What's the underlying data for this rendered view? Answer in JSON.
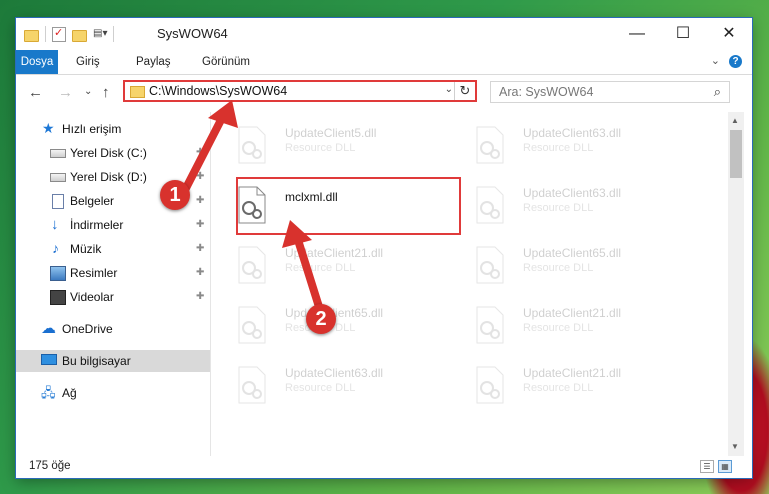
{
  "window": {
    "title": "SysWOW64",
    "minimize": "—",
    "maximize": "☐",
    "close": "✕"
  },
  "ribbon": {
    "tabs": [
      "Dosya",
      "Giriş",
      "Paylaş",
      "Görünüm"
    ],
    "expand": "⌄",
    "help": "?"
  },
  "nav": {
    "back": "←",
    "forward": "→",
    "recent": "⌄",
    "up": "↑"
  },
  "address": {
    "path": "C:\\Windows\\SysWOW64",
    "dropdown": "⌄",
    "refresh": "↻"
  },
  "search": {
    "placeholder": "Ara: SysWOW64",
    "icon": "⌕"
  },
  "sidebar": {
    "items": [
      {
        "label": "Hızlı erişim",
        "icon": "star-icon"
      },
      {
        "label": "Yerel Disk (C:)",
        "icon": "drive-icon",
        "pinned": true
      },
      {
        "label": "Yerel Disk (D:)",
        "icon": "drive-icon",
        "pinned": true
      },
      {
        "label": "Belgeler",
        "icon": "documents-icon",
        "pinned": true
      },
      {
        "label": "İndirmeler",
        "icon": "download-icon",
        "pinned": true
      },
      {
        "label": "Müzik",
        "icon": "music-icon",
        "pinned": true
      },
      {
        "label": "Resimler",
        "icon": "pictures-icon",
        "pinned": true
      },
      {
        "label": "Videolar",
        "icon": "videos-icon",
        "pinned": true
      },
      {
        "label": "OneDrive",
        "icon": "cloud-icon"
      },
      {
        "label": "Bu bilgisayar",
        "icon": "computer-icon",
        "selected": true
      },
      {
        "label": "Ağ",
        "icon": "network-icon"
      }
    ],
    "pin_glyph": "📌"
  },
  "files": [
    {
      "name": "UpdateClient5.dll",
      "type": "Resource DLL",
      "faded": true
    },
    {
      "name": "UpdateClient63.dll",
      "type": "Resource DLL",
      "faded": true
    },
    {
      "name": "mclxml.dll",
      "type": "",
      "faded": false
    },
    {
      "name": "UpdateClient63.dll",
      "type": "Resource DLL",
      "faded": true
    },
    {
      "name": "UpdateClient21.dll",
      "type": "Resource DLL",
      "faded": true
    },
    {
      "name": "UpdateClient65.dll",
      "type": "Resource DLL",
      "faded": true
    },
    {
      "name": "UpdateClient65.dll",
      "type": "Resource DLL",
      "faded": true
    },
    {
      "name": "UpdateClient21.dll",
      "type": "Resource DLL",
      "faded": true
    },
    {
      "name": "UpdateClient63.dll",
      "type": "Resource DLL",
      "faded": true
    },
    {
      "name": "UpdateClient21.dll",
      "type": "Resource DLL",
      "faded": true
    }
  ],
  "status": {
    "count": "175 öğe"
  },
  "annotations": {
    "step1": "1",
    "step2": "2",
    "color": "#d8322d"
  }
}
